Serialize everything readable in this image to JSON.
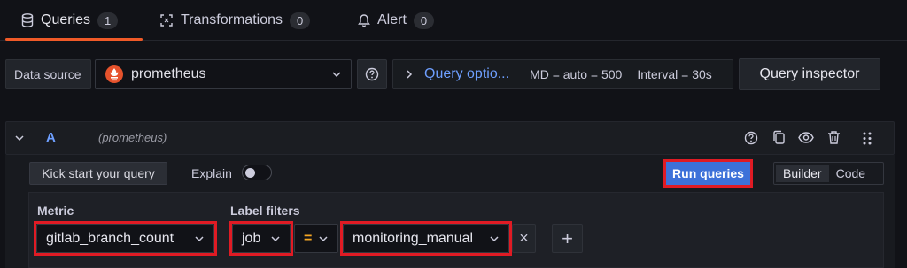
{
  "tabs": [
    {
      "label": "Queries",
      "count": "1",
      "icon": "database-icon"
    },
    {
      "label": "Transformations",
      "count": "0",
      "icon": "transform-icon"
    },
    {
      "label": "Alert",
      "count": "0",
      "icon": "bell-icon"
    }
  ],
  "datasource": {
    "label": "Data source",
    "value": "prometheus",
    "options_label": "Query optio...",
    "md": "MD = auto = 500",
    "interval": "Interval = 30s",
    "inspector": "Query inspector"
  },
  "query": {
    "letter": "A",
    "source": "(prometheus)",
    "kick_start": "Kick start your query",
    "explain": "Explain",
    "run": "Run queries",
    "builder": "Builder",
    "code": "Code"
  },
  "filters": {
    "metric_label": "Metric",
    "metric_value": "gitlab_branch_count",
    "label_filters_label": "Label filters",
    "label_key": "job",
    "operator": "=",
    "label_value": "monitoring_manual",
    "remove": "×",
    "add": "+"
  },
  "colors": {
    "accent": "#f05a28",
    "link": "#6e9fff",
    "run_button": "#3d71d9",
    "highlight": "#e01b24"
  }
}
